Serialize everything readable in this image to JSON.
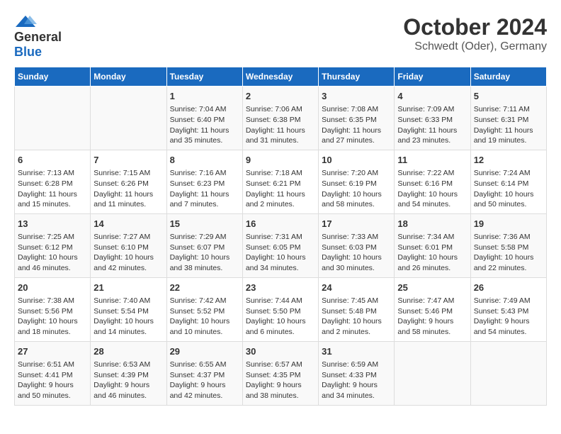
{
  "logo": {
    "line1": "General",
    "line2": "Blue"
  },
  "title": "October 2024",
  "subtitle": "Schwedt (Oder), Germany",
  "weekdays": [
    "Sunday",
    "Monday",
    "Tuesday",
    "Wednesday",
    "Thursday",
    "Friday",
    "Saturday"
  ],
  "weeks": [
    [
      {
        "day": "",
        "info": ""
      },
      {
        "day": "",
        "info": ""
      },
      {
        "day": "1",
        "info": "Sunrise: 7:04 AM\nSunset: 6:40 PM\nDaylight: 11 hours and 35 minutes."
      },
      {
        "day": "2",
        "info": "Sunrise: 7:06 AM\nSunset: 6:38 PM\nDaylight: 11 hours and 31 minutes."
      },
      {
        "day": "3",
        "info": "Sunrise: 7:08 AM\nSunset: 6:35 PM\nDaylight: 11 hours and 27 minutes."
      },
      {
        "day": "4",
        "info": "Sunrise: 7:09 AM\nSunset: 6:33 PM\nDaylight: 11 hours and 23 minutes."
      },
      {
        "day": "5",
        "info": "Sunrise: 7:11 AM\nSunset: 6:31 PM\nDaylight: 11 hours and 19 minutes."
      }
    ],
    [
      {
        "day": "6",
        "info": "Sunrise: 7:13 AM\nSunset: 6:28 PM\nDaylight: 11 hours and 15 minutes."
      },
      {
        "day": "7",
        "info": "Sunrise: 7:15 AM\nSunset: 6:26 PM\nDaylight: 11 hours and 11 minutes."
      },
      {
        "day": "8",
        "info": "Sunrise: 7:16 AM\nSunset: 6:23 PM\nDaylight: 11 hours and 7 minutes."
      },
      {
        "day": "9",
        "info": "Sunrise: 7:18 AM\nSunset: 6:21 PM\nDaylight: 11 hours and 2 minutes."
      },
      {
        "day": "10",
        "info": "Sunrise: 7:20 AM\nSunset: 6:19 PM\nDaylight: 10 hours and 58 minutes."
      },
      {
        "day": "11",
        "info": "Sunrise: 7:22 AM\nSunset: 6:16 PM\nDaylight: 10 hours and 54 minutes."
      },
      {
        "day": "12",
        "info": "Sunrise: 7:24 AM\nSunset: 6:14 PM\nDaylight: 10 hours and 50 minutes."
      }
    ],
    [
      {
        "day": "13",
        "info": "Sunrise: 7:25 AM\nSunset: 6:12 PM\nDaylight: 10 hours and 46 minutes."
      },
      {
        "day": "14",
        "info": "Sunrise: 7:27 AM\nSunset: 6:10 PM\nDaylight: 10 hours and 42 minutes."
      },
      {
        "day": "15",
        "info": "Sunrise: 7:29 AM\nSunset: 6:07 PM\nDaylight: 10 hours and 38 minutes."
      },
      {
        "day": "16",
        "info": "Sunrise: 7:31 AM\nSunset: 6:05 PM\nDaylight: 10 hours and 34 minutes."
      },
      {
        "day": "17",
        "info": "Sunrise: 7:33 AM\nSunset: 6:03 PM\nDaylight: 10 hours and 30 minutes."
      },
      {
        "day": "18",
        "info": "Sunrise: 7:34 AM\nSunset: 6:01 PM\nDaylight: 10 hours and 26 minutes."
      },
      {
        "day": "19",
        "info": "Sunrise: 7:36 AM\nSunset: 5:58 PM\nDaylight: 10 hours and 22 minutes."
      }
    ],
    [
      {
        "day": "20",
        "info": "Sunrise: 7:38 AM\nSunset: 5:56 PM\nDaylight: 10 hours and 18 minutes."
      },
      {
        "day": "21",
        "info": "Sunrise: 7:40 AM\nSunset: 5:54 PM\nDaylight: 10 hours and 14 minutes."
      },
      {
        "day": "22",
        "info": "Sunrise: 7:42 AM\nSunset: 5:52 PM\nDaylight: 10 hours and 10 minutes."
      },
      {
        "day": "23",
        "info": "Sunrise: 7:44 AM\nSunset: 5:50 PM\nDaylight: 10 hours and 6 minutes."
      },
      {
        "day": "24",
        "info": "Sunrise: 7:45 AM\nSunset: 5:48 PM\nDaylight: 10 hours and 2 minutes."
      },
      {
        "day": "25",
        "info": "Sunrise: 7:47 AM\nSunset: 5:46 PM\nDaylight: 9 hours and 58 minutes."
      },
      {
        "day": "26",
        "info": "Sunrise: 7:49 AM\nSunset: 5:43 PM\nDaylight: 9 hours and 54 minutes."
      }
    ],
    [
      {
        "day": "27",
        "info": "Sunrise: 6:51 AM\nSunset: 4:41 PM\nDaylight: 9 hours and 50 minutes."
      },
      {
        "day": "28",
        "info": "Sunrise: 6:53 AM\nSunset: 4:39 PM\nDaylight: 9 hours and 46 minutes."
      },
      {
        "day": "29",
        "info": "Sunrise: 6:55 AM\nSunset: 4:37 PM\nDaylight: 9 hours and 42 minutes."
      },
      {
        "day": "30",
        "info": "Sunrise: 6:57 AM\nSunset: 4:35 PM\nDaylight: 9 hours and 38 minutes."
      },
      {
        "day": "31",
        "info": "Sunrise: 6:59 AM\nSunset: 4:33 PM\nDaylight: 9 hours and 34 minutes."
      },
      {
        "day": "",
        "info": ""
      },
      {
        "day": "",
        "info": ""
      }
    ]
  ]
}
